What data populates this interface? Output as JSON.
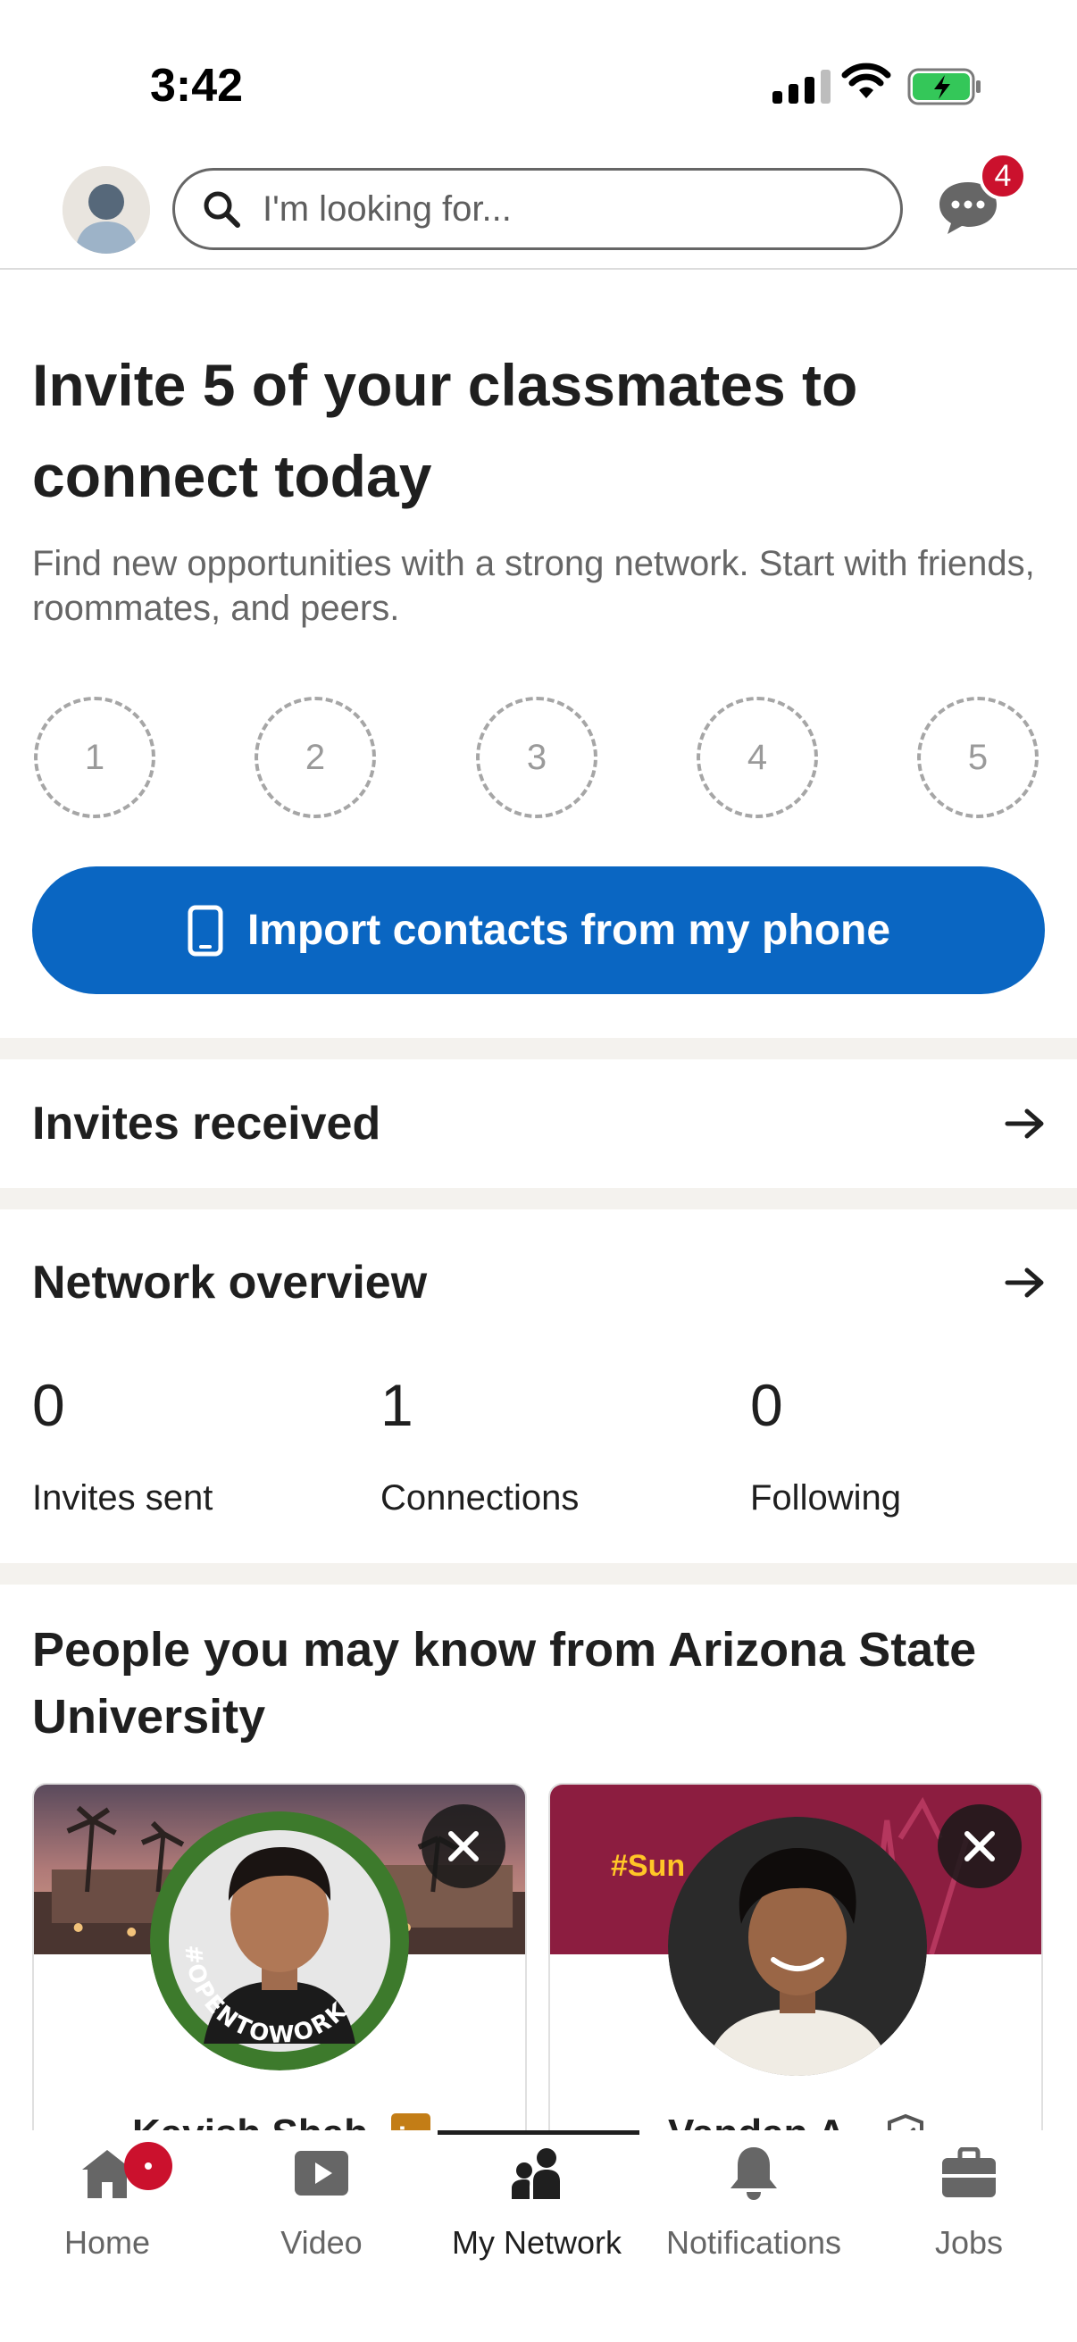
{
  "status_bar": {
    "time": "3:42"
  },
  "topbar": {
    "search_placeholder": "I'm looking for...",
    "messages_badge": "4"
  },
  "invite": {
    "title": "Invite 5 of your classmates to connect today",
    "subtitle": "Find new opportunities with a strong network. Start with friends, roommates, and peers.",
    "slots": [
      "1",
      "2",
      "3",
      "4",
      "5"
    ],
    "import_button": "Import contacts from my phone"
  },
  "invites_received": {
    "label": "Invites received"
  },
  "network_overview": {
    "label": "Network overview",
    "stats": [
      {
        "value": "0",
        "label": "Invites sent"
      },
      {
        "value": "1",
        "label": "Connections"
      },
      {
        "value": "0",
        "label": "Following"
      }
    ]
  },
  "pymk": {
    "title": "People you may know from Arizona State University",
    "cards": [
      {
        "name": "Kavish Shah",
        "frame_text": "#OPENTOWORK"
      },
      {
        "name": "Vandan A.",
        "banner_text": "#Sun"
      }
    ]
  },
  "bottom_nav": {
    "items": [
      {
        "label": "Home",
        "icon": "home-icon"
      },
      {
        "label": "Video",
        "icon": "video-icon"
      },
      {
        "label": "My Network",
        "icon": "network-icon"
      },
      {
        "label": "Notifications",
        "icon": "bell-icon"
      },
      {
        "label": "Jobs",
        "icon": "briefcase-icon"
      }
    ],
    "active": "My Network"
  },
  "colors": {
    "primary": "#0a66c2",
    "badge": "#cb112d",
    "separator": "#f4f2ee",
    "open_to_work": "#3d7a2c"
  }
}
